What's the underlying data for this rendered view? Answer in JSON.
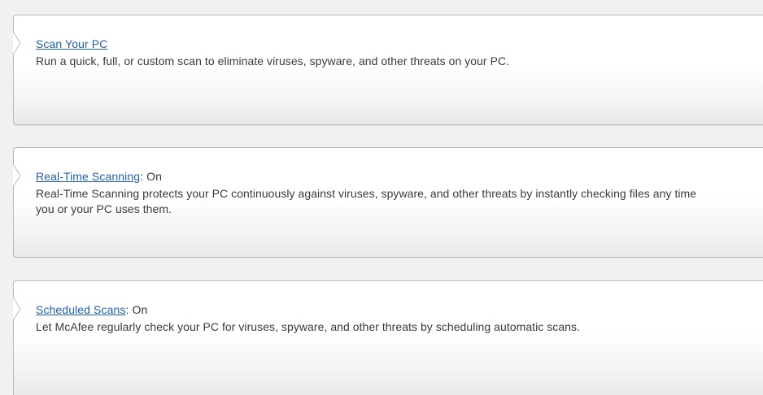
{
  "panels": [
    {
      "link": "Scan Your PC",
      "status_prefix": "",
      "status": "",
      "description": "Run a quick, full, or custom scan to eliminate viruses, spyware, and other threats on your PC."
    },
    {
      "link": "Real-Time Scanning",
      "status_prefix": ": ",
      "status": "On",
      "description": "Real-Time Scanning protects your PC continuously against viruses, spyware, and other threats by instantly checking files any time you or your PC uses them."
    },
    {
      "link": "Scheduled Scans",
      "status_prefix": ": ",
      "status": "On",
      "description": "Let McAfee regularly check your PC for viruses, spyware, and other threats by scheduling automatic scans."
    }
  ],
  "colors": {
    "link": "#1f5fb5",
    "text": "#333333",
    "border": "#b9b9b9",
    "background": "#f1f1f1"
  }
}
